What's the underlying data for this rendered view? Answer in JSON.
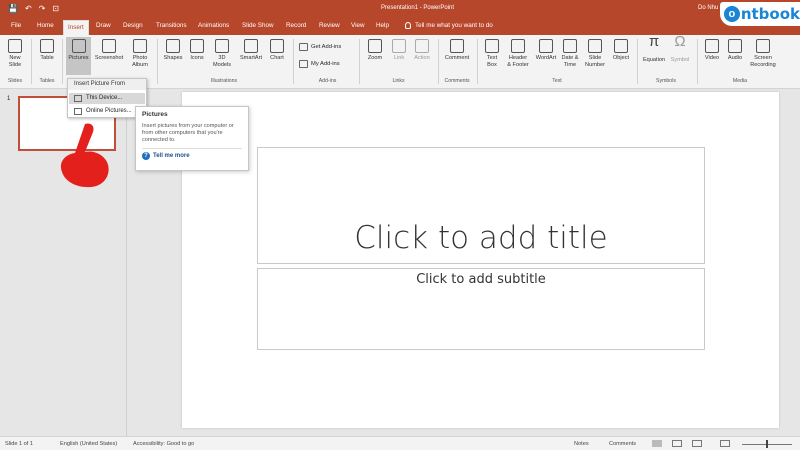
{
  "qat": {
    "save": "💾",
    "undo": "↶",
    "redo": "↷",
    "present": "⊡"
  },
  "window": {
    "doc_title": "Presentation1 - PowerPoint",
    "user": "Do Nhu"
  },
  "tabs": [
    "File",
    "Home",
    "Insert",
    "Draw",
    "Design",
    "Transitions",
    "Animations",
    "Slide Show",
    "Record",
    "Review",
    "View",
    "Help"
  ],
  "tellme": "Tell me what you want to do",
  "ribbon": {
    "slides": {
      "new_slide": "New\nSlide",
      "group": "Slides"
    },
    "tables": {
      "table": "Table",
      "group": "Tables"
    },
    "images": {
      "pictures": "Pictures",
      "screenshot": "Screenshot",
      "photo_album": "Photo\nAlbum"
    },
    "illustrations": {
      "shapes": "Shapes",
      "icons": "Icons",
      "models": "3D\nModels",
      "smartart": "SmartArt",
      "chart": "Chart",
      "group": "Illustrations"
    },
    "addins": {
      "get": "Get Add-ins",
      "my": "My Add-ins",
      "group": "Add-ins"
    },
    "links": {
      "zoom": "Zoom",
      "link": "Link",
      "action": "Action",
      "group": "Links"
    },
    "comments": {
      "comment": "Comment",
      "group": "Comments"
    },
    "text": {
      "textbox": "Text\nBox",
      "header": "Header\n& Footer",
      "wordart": "WordArt",
      "datetime": "Date &\nTime",
      "slidenumber": "Slide\nNumber",
      "object": "Object",
      "group": "Text"
    },
    "symbols": {
      "equation": "Equation",
      "symbol": "Symbol",
      "group": "Symbols"
    },
    "media": {
      "video": "Video",
      "audio": "Audio",
      "screenrec": "Screen\nRecording",
      "group": "Media"
    }
  },
  "dropdown": {
    "header": "Insert Picture From",
    "items": [
      "This Device...",
      "Online Pictures..."
    ]
  },
  "tooltip": {
    "title": "Pictures",
    "body": "Insert pictures from your computer or from other computers that you're connected to.",
    "link": "Tell me more"
  },
  "slide": {
    "number": "1",
    "title": "Click to add title",
    "subtitle": "Click to add subtitle"
  },
  "status": {
    "slide": "Slide 1 of 1",
    "lang": "English (United States)",
    "access": "Accessibility: Good to go",
    "notes": "Notes",
    "comments": "Comments"
  },
  "logo": {
    "letter": "o",
    "text": "ntbook"
  },
  "colors": {
    "accent": "#b7472a",
    "pointer": "#e3201b",
    "logo": "#1a84d6"
  }
}
